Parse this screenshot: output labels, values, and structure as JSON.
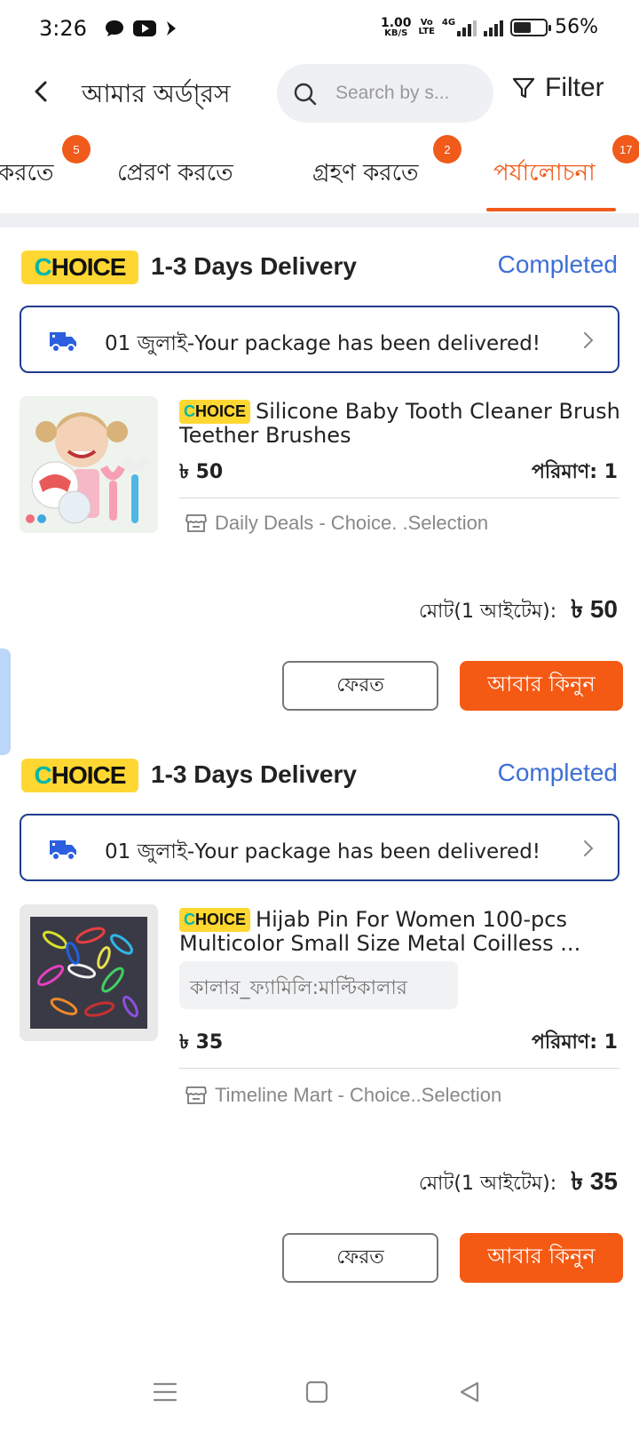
{
  "status_bar": {
    "time": "3:26",
    "speed_value": "1.00",
    "speed_unit": "KB/S",
    "volte_top": "Vo",
    "volte_bottom": "LTE",
    "network": "4G",
    "battery_percent": "56%",
    "battery_level": 0.56
  },
  "header": {
    "title": "আমার অর্ডা্রস",
    "search_placeholder": "Search by s...",
    "filter_label": "Filter"
  },
  "tabs": [
    {
      "label": "করতে",
      "badge": "5"
    },
    {
      "label": "প্রেরণ করতে",
      "badge": ""
    },
    {
      "label": "গ্রহণ করতে",
      "badge": "2"
    },
    {
      "label": "পর্যালোচনা",
      "badge": "17",
      "active": true
    }
  ],
  "orders": [
    {
      "choice_logo": "CHOICE",
      "delivery": "1-3 Days Delivery",
      "status": "Completed",
      "notice": "01 জুলাই-Your package has been delivered!",
      "product_badge": "CHOICE",
      "product_name": "Silicone Baby Tooth Cleaner Brush Teether Brushes",
      "price": "৳ 50",
      "quantity": "পরিমাণ: 1",
      "store": "Daily Deals - Choice. .Selection",
      "total_label": "মোট(1 আইটেম):",
      "total_amount": "৳ 50",
      "return_label": "ফেরত",
      "buy_again_label": "আবার কিনুন"
    },
    {
      "choice_logo": "CHOICE",
      "delivery": "1-3 Days Delivery",
      "status": "Completed",
      "notice": "01 জুলাই-Your package has been delivered!",
      "product_badge": "CHOICE",
      "product_name": "Hijab Pin For Women 100-pcs Multicolor Small Size Metal Coilless ...",
      "variant": "কালার_ফ্যামিলি:মাল্টিকালার",
      "price": "৳ 35",
      "quantity": "পরিমাণ: 1",
      "store": "Timeline Mart - Choice..Selection",
      "total_label": "মোট(1 আইটেম):",
      "total_amount": "৳ 35",
      "return_label": "ফেরত",
      "buy_again_label": "আবার কিনুন"
    }
  ],
  "colors": {
    "accent": "#f45a14",
    "status_blue": "#3d6fd6",
    "choice_yellow": "#ffd733",
    "notice_border": "#1f3d8f"
  }
}
